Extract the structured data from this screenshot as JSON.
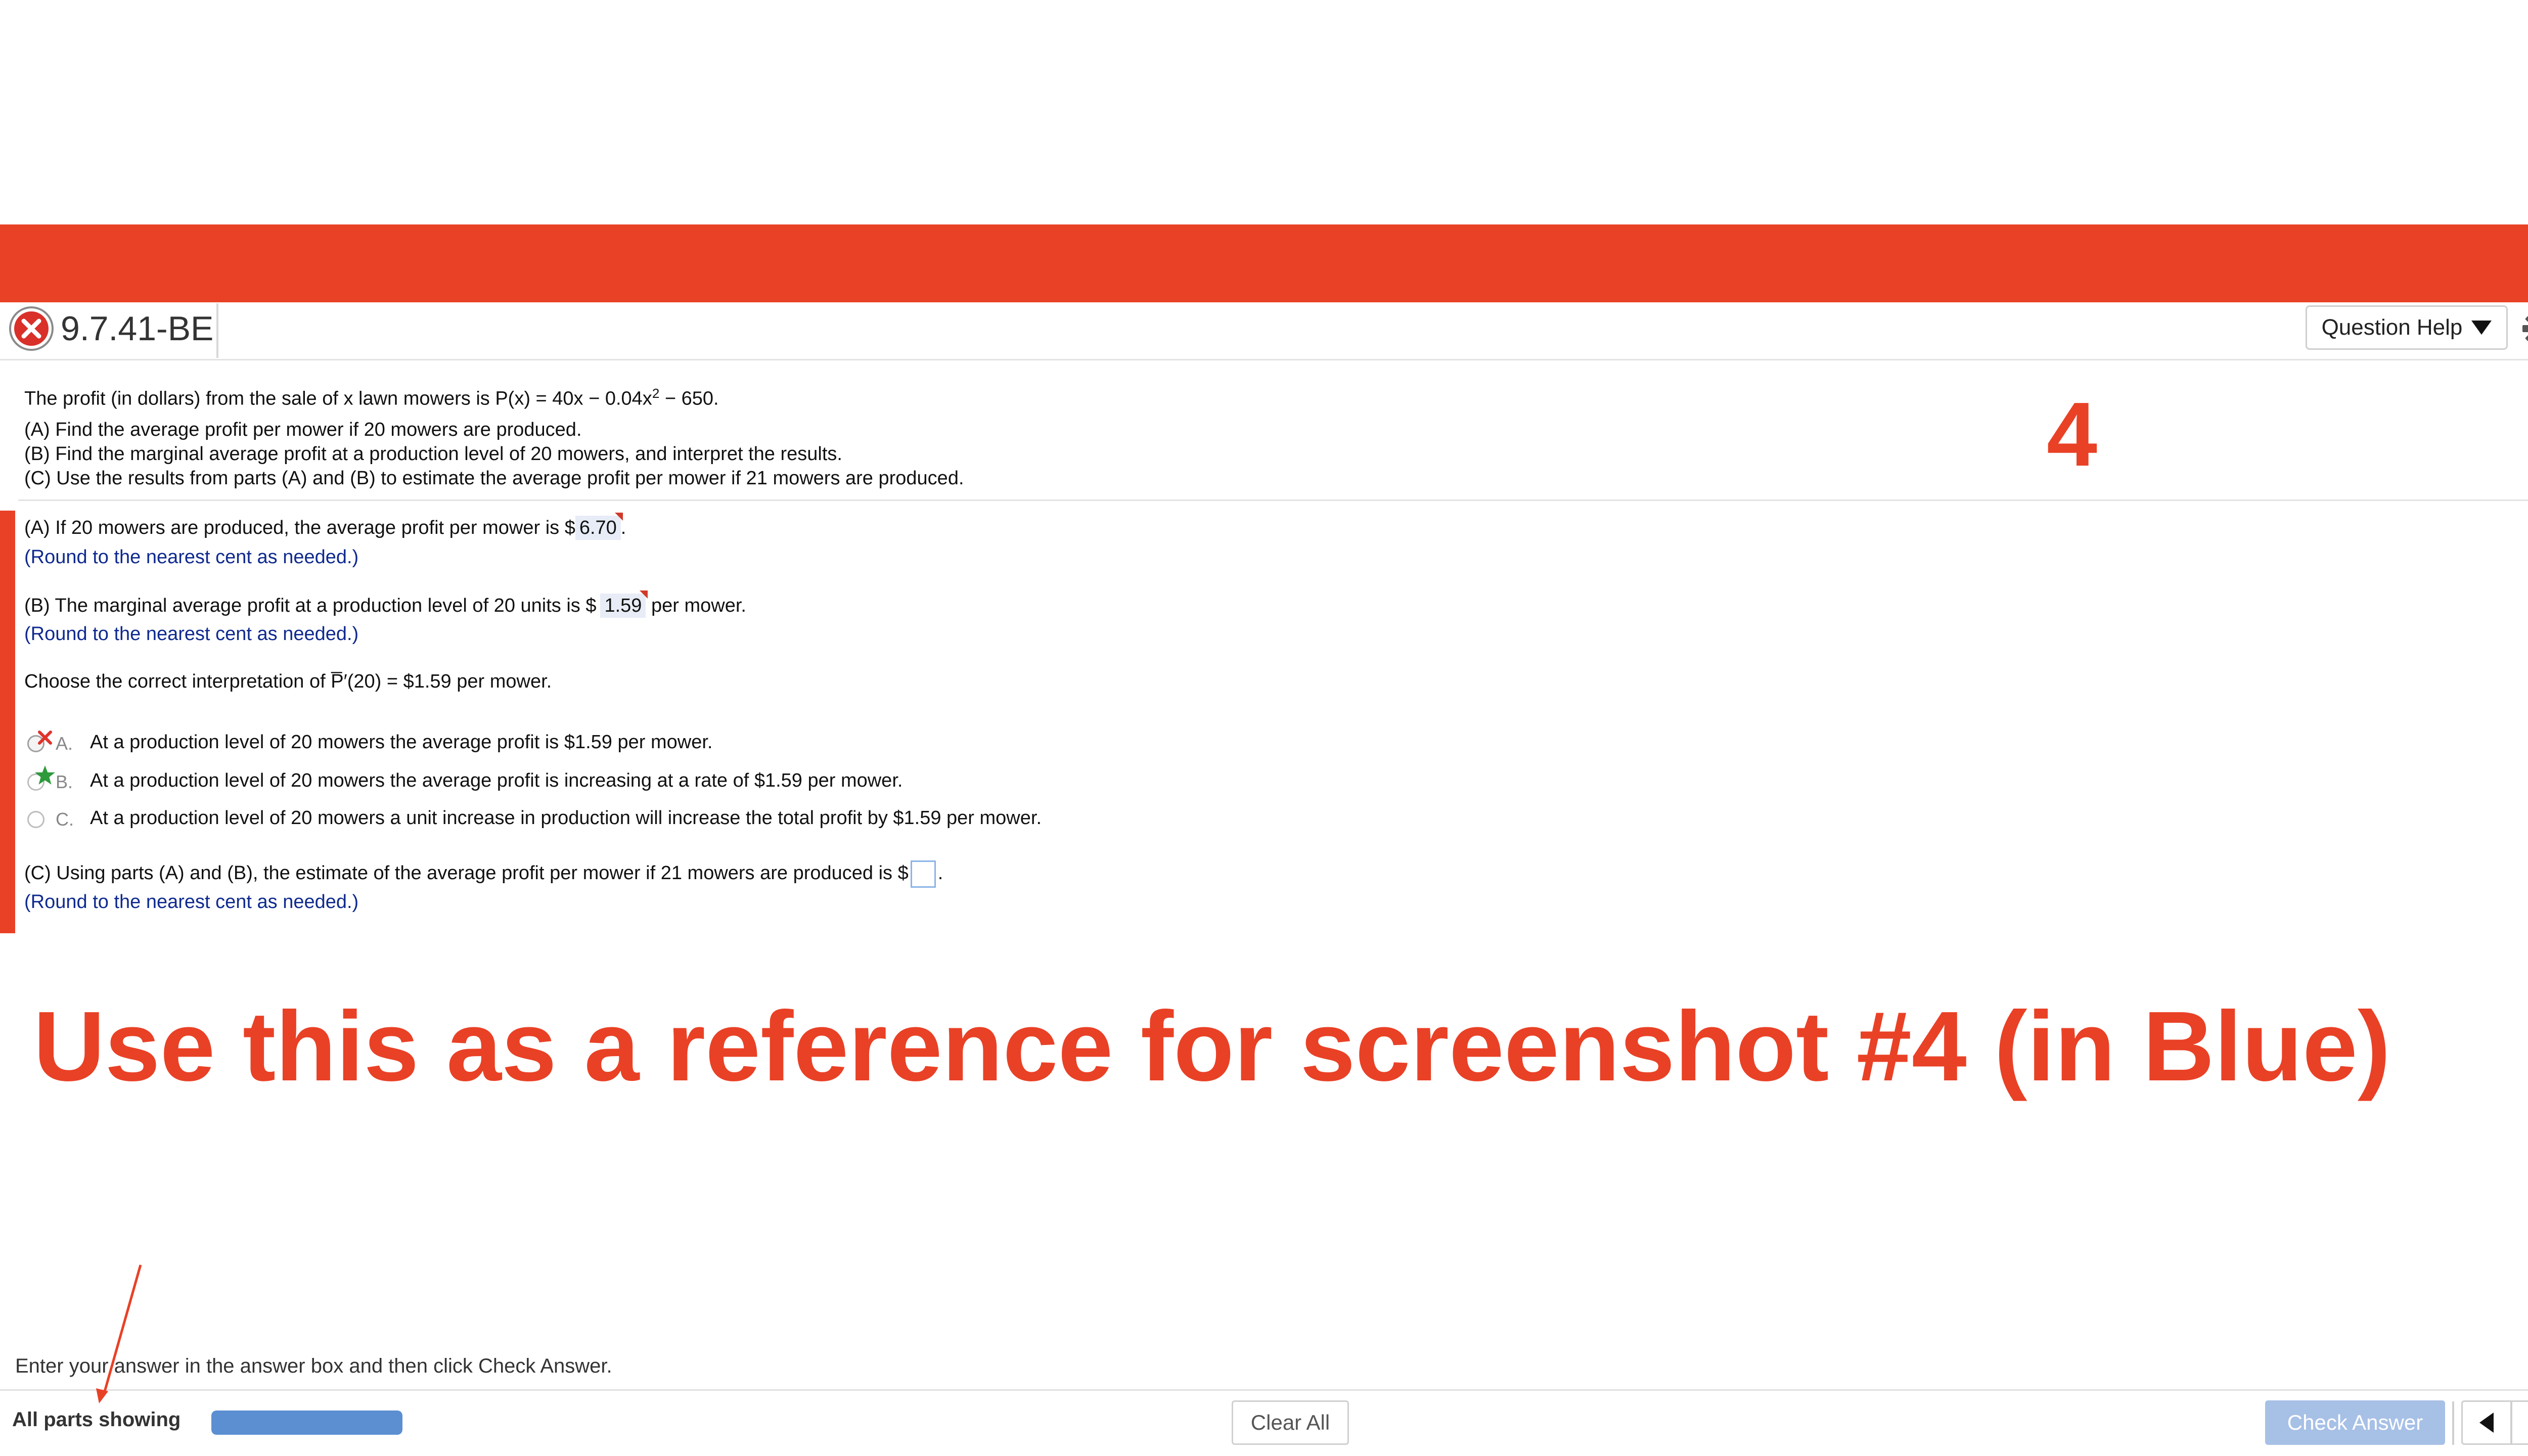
{
  "header": {
    "question_id": "9.7.41-BE",
    "question_help_label": "Question Help"
  },
  "stem": {
    "profit_prefix": "The profit (in dollars) from the sale of x lawn mowers is P(x) = 40x − 0.04x",
    "profit_exp": "2",
    "profit_suffix": " − 650.",
    "part_a": "(A) Find the average profit per mower if 20 mowers are produced.",
    "part_b": "(B) Find the marginal average profit at a production level of 20 mowers, and interpret the results.",
    "part_c": "(C) Use the results from parts (A) and (B) to estimate the average profit per mower if 21 mowers are produced."
  },
  "answers": {
    "a_prefix": "(A)  If 20 mowers are produced, the average profit per mower is $",
    "a_value": "6.70",
    "a_suffix": ".",
    "round_hint": "(Round to the nearest cent as needed.)",
    "b_prefix": "(B)  The marginal average profit at a production level of 20 units is $",
    "b_value": "1.59",
    "b_suffix": " per mower.",
    "interp_prefix": "Choose the correct interpretation of ",
    "interp_symbol": "P̅′",
    "interp_suffix": "(20) = $1.59 per mower.",
    "options": [
      {
        "letter": "A.",
        "text": "At a production level of 20 mowers the average profit is $1.59 per mower."
      },
      {
        "letter": "B.",
        "text": "At a production level of 20 mowers the average profit is increasing at a rate of $1.59 per mower."
      },
      {
        "letter": "C.",
        "text": "At a production level of 20 mowers a unit increase in production will increase the total profit by $1.59 per mower."
      }
    ],
    "c_prefix": "(C)  Using parts (A) and (B), the estimate of the average profit per mower if 21 mowers are produced is $",
    "c_suffix": "."
  },
  "annotations": {
    "number": "4",
    "banner": "Use this as a reference for screenshot #4 (in Blue)"
  },
  "footer": {
    "instruction": "Enter your answer in the answer box and then click Check Answer.",
    "parts_label": "All parts showing",
    "progress_fraction": 1.0,
    "clear_all_label": "Clear All",
    "check_answer_label": "Check Answer",
    "help_glyph": "?"
  },
  "colors": {
    "accent_red": "#e94126",
    "hint_blue": "#0f2a8f",
    "progress_blue": "#5b8fd1",
    "check_button": "#a7c0e6"
  }
}
